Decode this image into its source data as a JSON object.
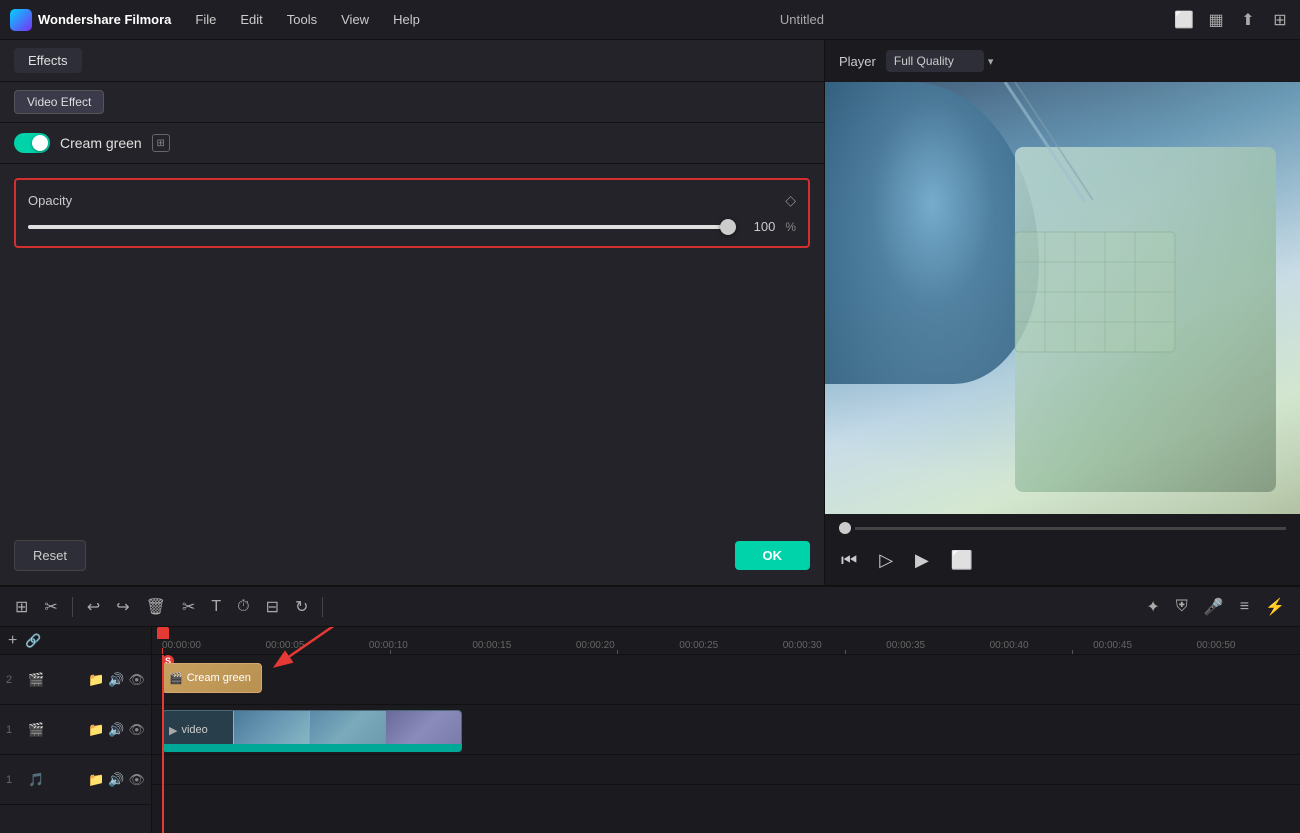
{
  "app": {
    "name": "Wondershare Filmora",
    "title": "Untitled"
  },
  "menubar": {
    "items": [
      "File",
      "Edit",
      "Tools",
      "View",
      "Help"
    ],
    "icons": [
      "monitor-icon",
      "layout-icon",
      "upload-icon",
      "grid-icon"
    ]
  },
  "effects_panel": {
    "tab_label": "Effects",
    "video_effect_btn": "Video Effect",
    "effect_name": "Cream green",
    "toggle_on": true,
    "opacity_label": "Opacity",
    "opacity_value": "100",
    "opacity_unit": "%",
    "reset_btn": "Reset",
    "ok_btn": "OK"
  },
  "player": {
    "label": "Player",
    "quality": "Full Quality"
  },
  "timeline": {
    "timescale": [
      "00:00:00",
      "00:00:05",
      "00:00:10",
      "00:00:15",
      "00:00:20",
      "00:00:25",
      "00:00:30",
      "00:00:35",
      "00:00:40",
      "00:00:45",
      "00:00:50"
    ],
    "tracks": [
      {
        "num": "2",
        "type": "video",
        "label": "Cream green"
      },
      {
        "num": "1",
        "type": "video",
        "label": "video"
      },
      {
        "num": "1",
        "type": "audio",
        "label": ""
      }
    ]
  }
}
